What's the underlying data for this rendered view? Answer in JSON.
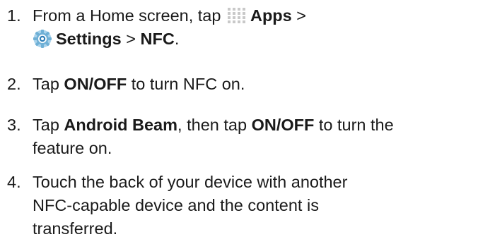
{
  "steps": [
    {
      "number": "1.",
      "line1_prefix": "From a Home screen, tap",
      "apps_label": "Apps",
      "sep1": " >",
      "settings_label": "Settings",
      "sep2": " > ",
      "nfc_label": "NFC",
      "end": "."
    },
    {
      "number": "2.",
      "prefix": "Tap ",
      "bold": "ON/OFF",
      "suffix": " to turn NFC on."
    },
    {
      "number": "3.",
      "prefix": "Tap ",
      "bold1": "Android Beam",
      "middle": ", then tap ",
      "bold2": "ON/OFF",
      "suffix": " to turn the",
      "line2": "feature on."
    },
    {
      "number": "4.",
      "line1": "Touch the back of your device with another",
      "line2": "NFC-capable device and the content is",
      "line3": "transferred."
    }
  ],
  "icons": {
    "apps": "apps-grid-icon",
    "settings": "settings-gear-icon"
  },
  "colors": {
    "text": "#1a1a1a",
    "apps_icon": "#c9c9c9",
    "settings_icon_outer": "#6fb0d6",
    "settings_icon_inner": "#2f7fb8"
  }
}
